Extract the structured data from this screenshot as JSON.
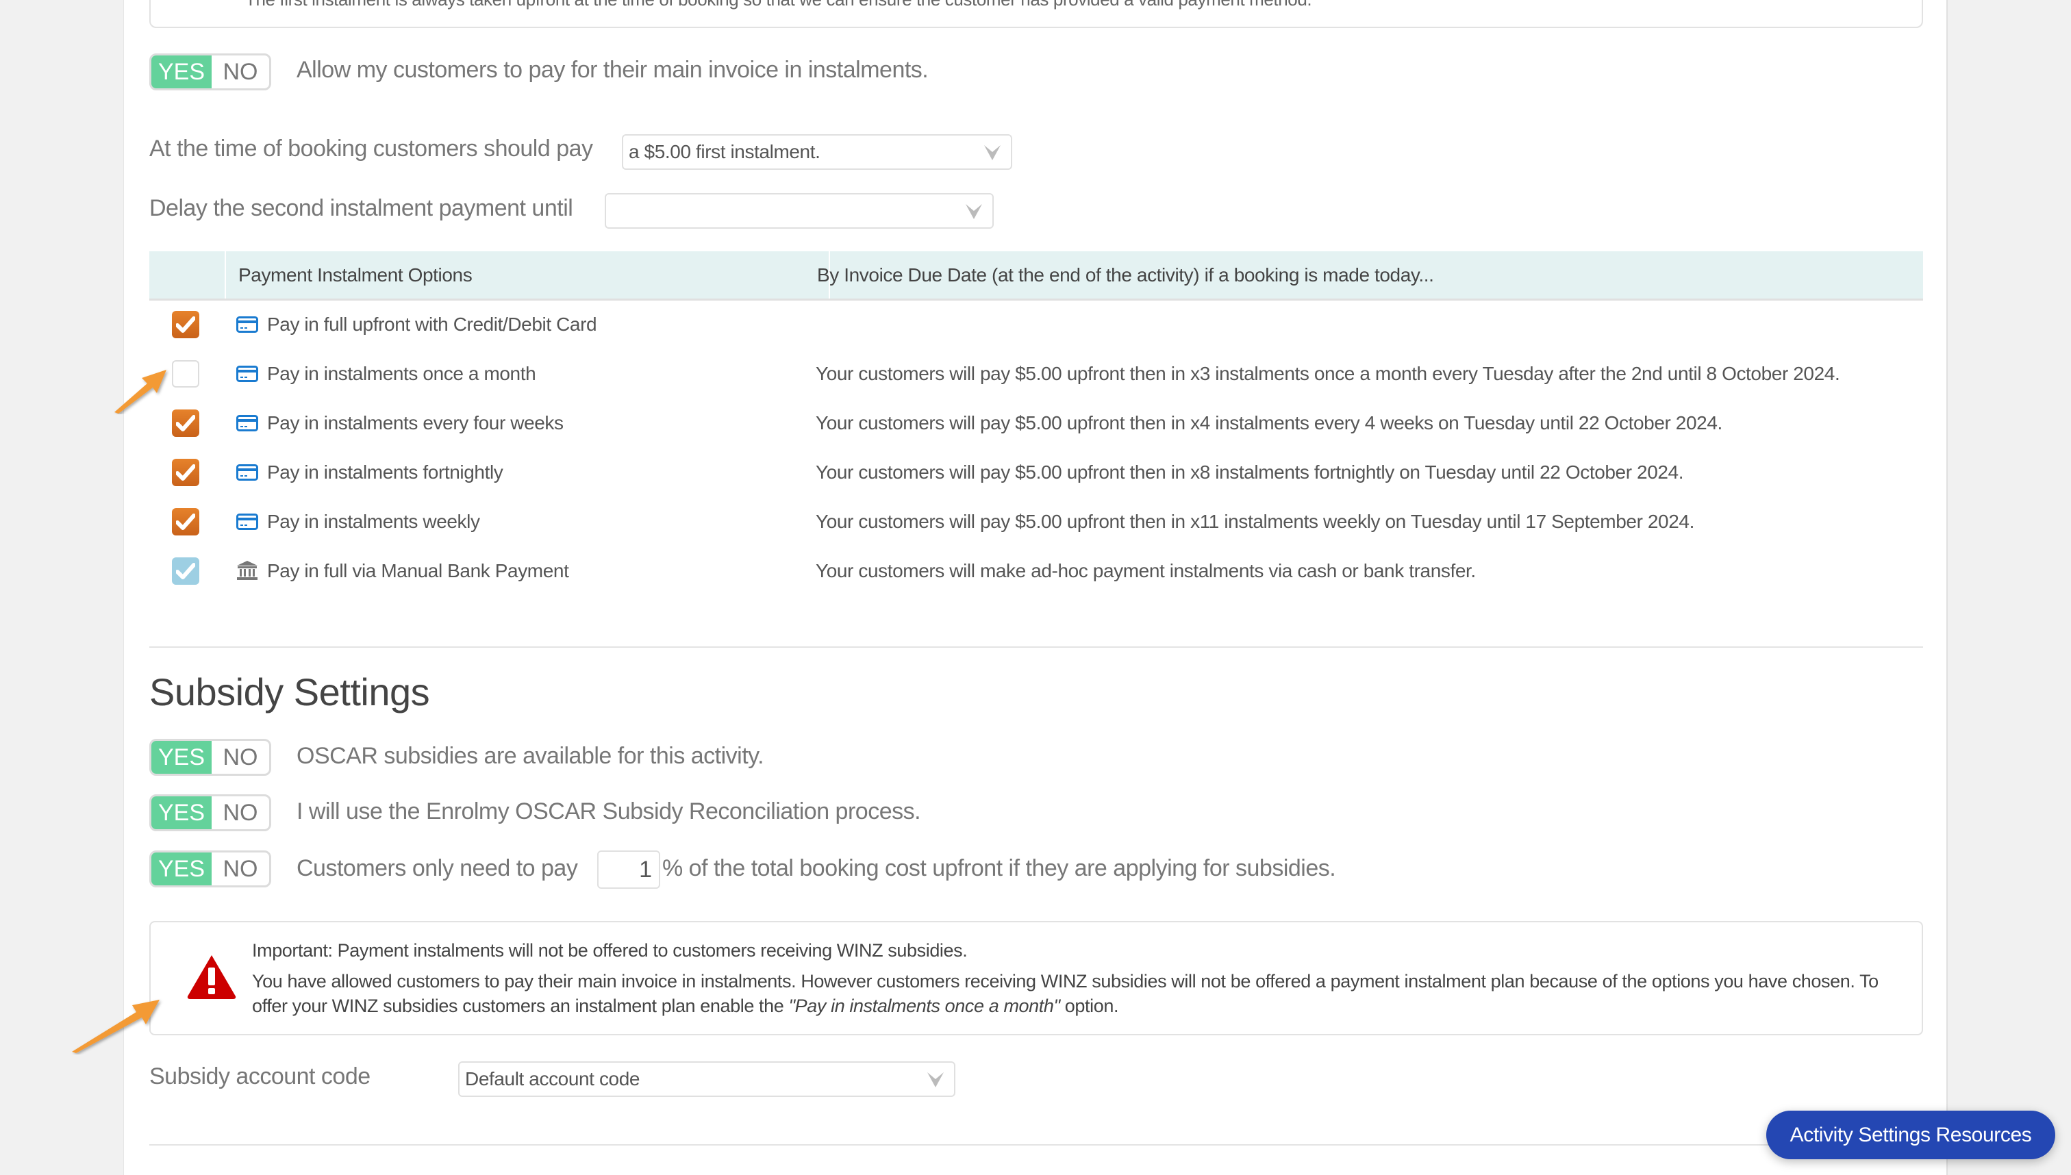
{
  "info_note": "The first instalment is always taken upfront at the time of booking so that we can ensure the customer has provided a valid payment method.",
  "toggle_labels": {
    "yes": "YES",
    "no": "NO"
  },
  "instalments": {
    "allow_toggle": {
      "state": "YES",
      "label": "Allow my customers to pay for their main invoice in instalments."
    },
    "booking_pay_label": "At the time of booking customers should pay",
    "booking_pay_value": "a $5.00 first instalment.",
    "delay_label": "Delay the second instalment payment until",
    "delay_value": ""
  },
  "table": {
    "headers": [
      "Payment Instalment Options",
      "By Invoice Due Date (at the end of the activity) if a booking is made today..."
    ],
    "rows": [
      {
        "checked": "checked",
        "icon": "credit-card-icon",
        "label": "Pay in full upfront with Credit/Debit Card",
        "desc": ""
      },
      {
        "checked": "unchecked",
        "icon": "credit-card-icon",
        "label": "Pay in instalments once a month",
        "desc": "Your customers will pay $5.00 upfront then in x3 instalments once a month every Tuesday after the 2nd until 8 October 2024."
      },
      {
        "checked": "checked",
        "icon": "credit-card-icon",
        "label": "Pay in instalments every four weeks",
        "desc": "Your customers will pay $5.00 upfront then in x4 instalments every 4 weeks on Tuesday until 22 October 2024."
      },
      {
        "checked": "checked",
        "icon": "credit-card-icon",
        "label": "Pay in instalments fortnightly",
        "desc": "Your customers will pay $5.00 upfront then in x8 instalments fortnightly on Tuesday until 22 October 2024."
      },
      {
        "checked": "checked",
        "icon": "credit-card-icon",
        "label": "Pay in instalments weekly",
        "desc": "Your customers will pay $5.00 upfront then in x11 instalments weekly on Tuesday until 17 September 2024."
      },
      {
        "checked": "checked-disabled",
        "icon": "bank-icon",
        "label": "Pay in full via Manual Bank Payment",
        "desc": "Your customers will make ad-hoc payment instalments via cash or bank transfer."
      }
    ]
  },
  "subsidy": {
    "heading": "Subsidy Settings",
    "toggles": [
      {
        "state": "YES",
        "label": "OSCAR subsidies are available for this activity."
      },
      {
        "state": "YES",
        "label": "I will use the Enrolmy OSCAR Subsidy Reconciliation process."
      },
      {
        "state": "YES",
        "label_before": "Customers only need to pay",
        "percent_value": "1",
        "label_after": "% of the total booking cost upfront if they are applying for subsidies."
      }
    ],
    "warning": {
      "title": "Important: Payment instalments will not be offered to customers receiving WINZ subsidies.",
      "body_before": "You have allowed customers to pay their main invoice in instalments. However customers receiving WINZ subsidies will not be offered a payment instalment plan because of the options you have chosen. To offer your WINZ subsidies customers an instalment plan enable the ",
      "body_emphasis": "\"Pay in instalments once a month\"",
      "body_after": " option."
    },
    "account_code_label": "Subsidy account code",
    "account_code_value": "Default account code"
  },
  "floating_button": "Activity Settings Resources",
  "colors": {
    "toggle_yes": "#64d29b",
    "checkbox_checked": "#e07a26",
    "checkbox_disabled": "#9dcfe3",
    "table_header_bg": "#e4f2f2",
    "card_icon": "#1a7bd0",
    "warning_red": "#cc0000",
    "annotation_arrow": "#f39a34",
    "fab_bg": "#2447b3"
  }
}
